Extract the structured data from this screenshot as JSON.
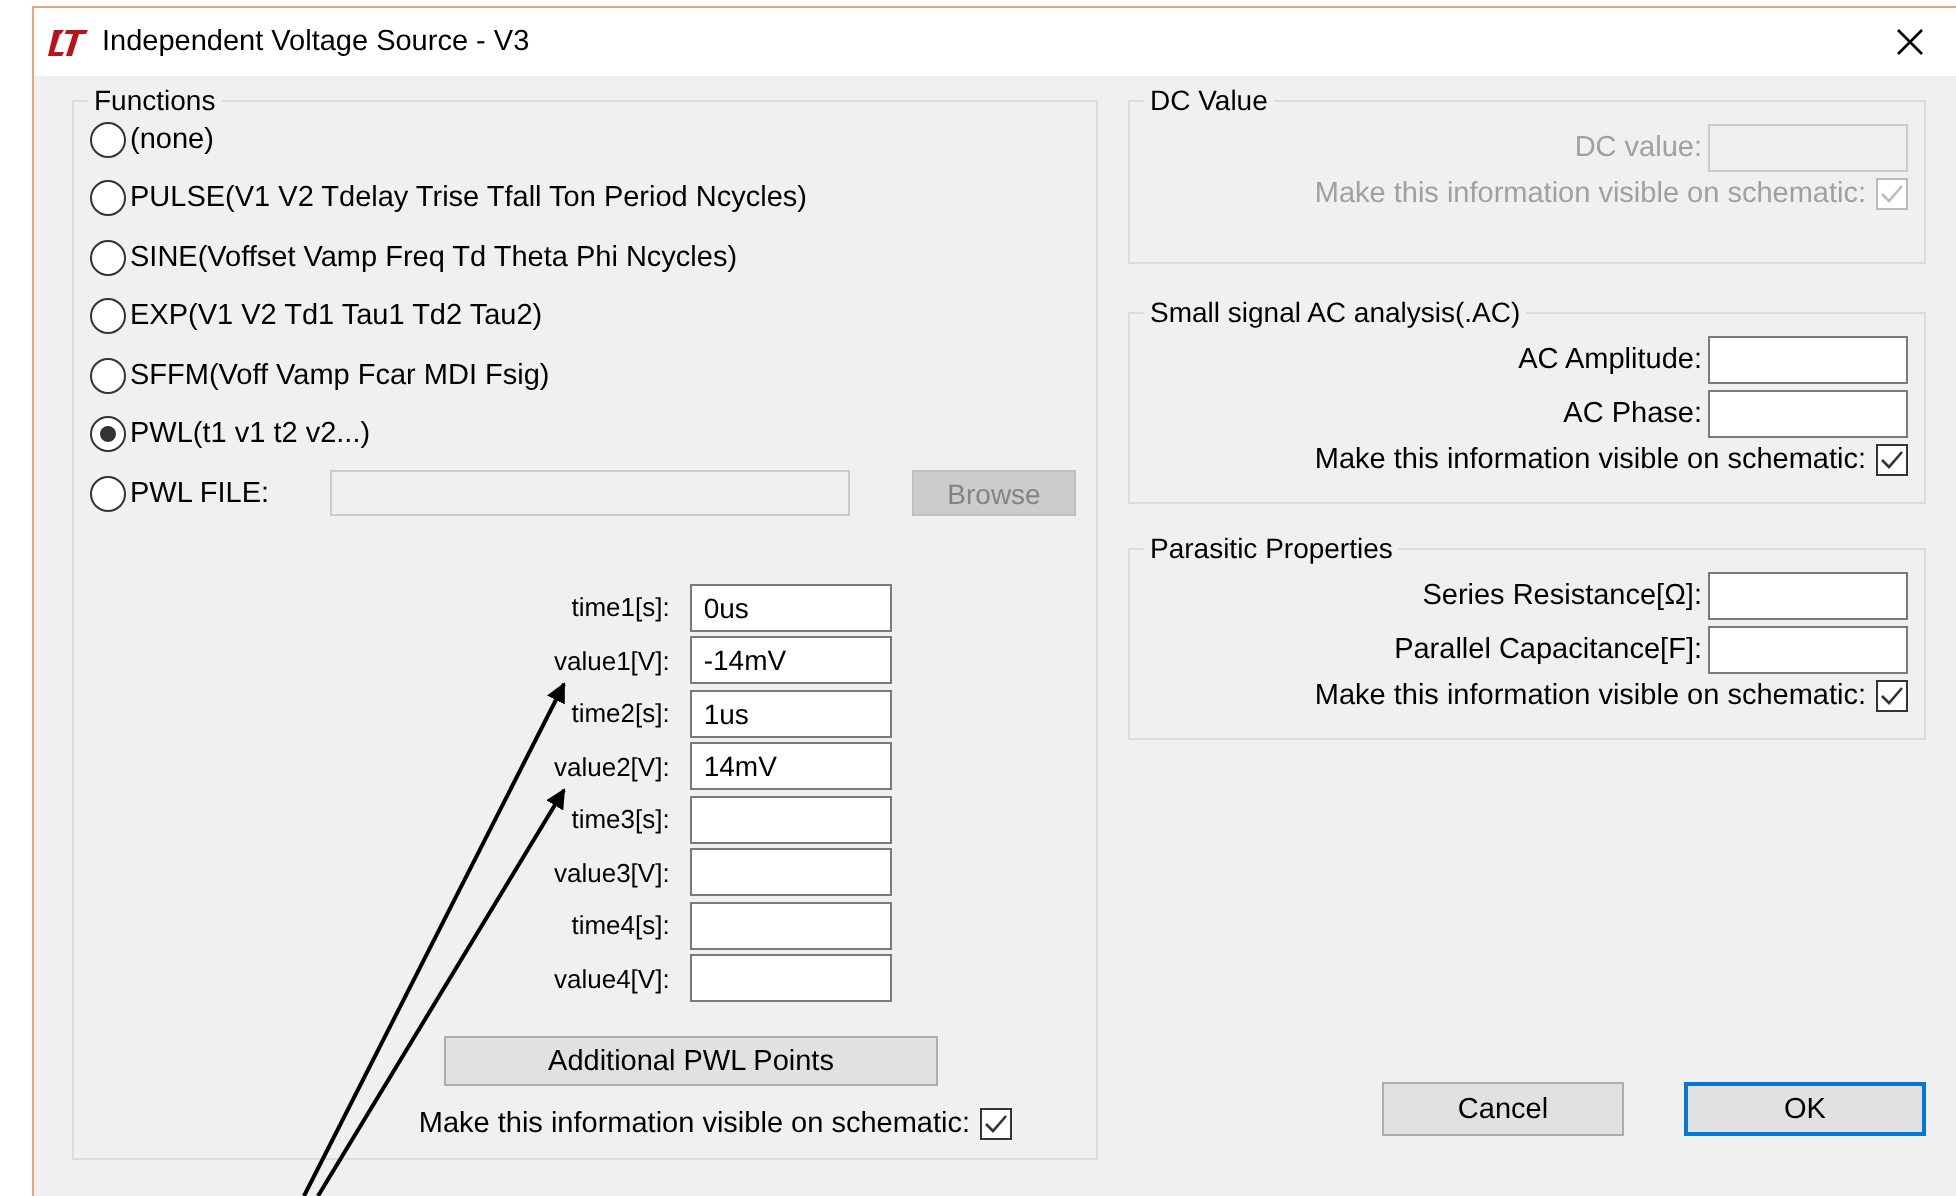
{
  "window": {
    "title": "Independent Voltage Source - V3"
  },
  "functions": {
    "title": "Functions",
    "options": [
      {
        "label": "(none)",
        "selected": false
      },
      {
        "label": "PULSE(V1 V2 Tdelay Trise Tfall Ton Period Ncycles)",
        "selected": false
      },
      {
        "label": "SINE(Voffset Vamp Freq Td Theta Phi Ncycles)",
        "selected": false
      },
      {
        "label": "EXP(V1 V2 Td1 Tau1 Td2 Tau2)",
        "selected": false
      },
      {
        "label": "SFFM(Voff Vamp Fcar MDI Fsig)",
        "selected": false
      },
      {
        "label": "PWL(t1 v1 t2 v2...)",
        "selected": true
      },
      {
        "label": "PWL FILE:",
        "selected": false
      }
    ],
    "pwl_file": {
      "disabled": true
    },
    "browse": {
      "label": "Browse",
      "disabled": true
    },
    "points": [
      {
        "label": "time1[s]:",
        "value": "0us"
      },
      {
        "label": "value1[V]:",
        "value": "-14mV"
      },
      {
        "label": "time2[s]:",
        "value": "1us"
      },
      {
        "label": "value2[V]:",
        "value": "14mV"
      },
      {
        "label": "time3[s]:"
      },
      {
        "label": "value3[V]:"
      },
      {
        "label": "time4[s]:"
      },
      {
        "label": "value4[V]:"
      }
    ],
    "additional_button": "Additional PWL Points",
    "visible": {
      "label": "Make this information visible on schematic:",
      "checked": true
    }
  },
  "dc": {
    "title": "DC Value",
    "disabled": true,
    "fields": [
      {
        "label": "DC value:"
      }
    ],
    "visible": {
      "label": "Make this information visible on schematic:",
      "checked": true
    }
  },
  "ac": {
    "title": "Small signal AC analysis(.AC)",
    "disabled": false,
    "fields": [
      {
        "label": "AC Amplitude:"
      },
      {
        "label": "AC Phase:"
      }
    ],
    "visible": {
      "label": "Make this information visible on schematic:",
      "checked": true
    }
  },
  "parasitic": {
    "title": "Parasitic Properties",
    "disabled": false,
    "fields": [
      {
        "label": "Series Resistance[Ω]:"
      },
      {
        "label": "Parallel Capacitance[F]:"
      }
    ],
    "visible": {
      "label": "Make this information visible on schematic:",
      "checked": true
    }
  },
  "buttons": [
    {
      "label": "Cancel",
      "default": false
    },
    {
      "label": "OK",
      "default": true
    }
  ]
}
